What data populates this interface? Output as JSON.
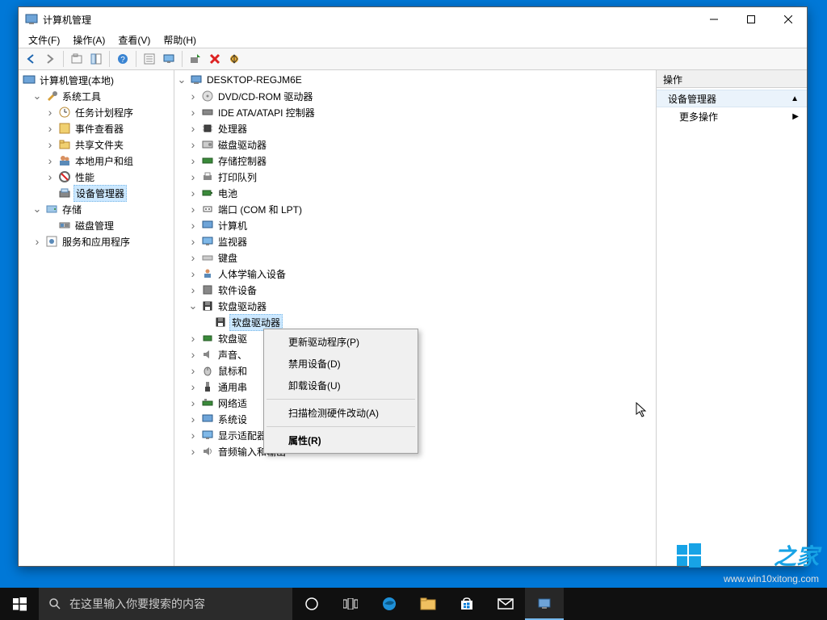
{
  "window": {
    "title": "计算机管理",
    "menus": [
      "文件(F)",
      "操作(A)",
      "查看(V)",
      "帮助(H)"
    ]
  },
  "left_tree": {
    "root": "计算机管理(本地)",
    "system_tools": "系统工具",
    "system_children": [
      "任务计划程序",
      "事件查看器",
      "共享文件夹",
      "本地用户和组",
      "性能",
      "设备管理器"
    ],
    "storage": "存储",
    "storage_children": [
      "磁盘管理"
    ],
    "services": "服务和应用程序"
  },
  "mid_tree": {
    "root": "DESKTOP-REGJM6E",
    "categories": [
      "DVD/CD-ROM 驱动器",
      "IDE ATA/ATAPI 控制器",
      "处理器",
      "磁盘驱动器",
      "存储控制器",
      "打印队列",
      "电池",
      "端口 (COM 和 LPT)",
      "计算机",
      "监视器",
      "键盘",
      "人体学输入设备",
      "软件设备",
      "软盘驱动器",
      "软盘驱动器_child",
      "软盘驱动器控制器",
      "声音、视频和游戏控制器",
      "鼠标和其他指针设备",
      "通用串行总线控制器",
      "网络适配器",
      "系统设备",
      "显示适配器",
      "音频输入和输出"
    ],
    "selected_device": "软盘驱动器",
    "truncated": {
      "floppy_ctrl": "软盘驱",
      "sound": "声音、",
      "mouse": "鼠标和",
      "usb": "通用串",
      "network": "网络适",
      "system": "系统设"
    }
  },
  "context_menu": {
    "items": [
      "更新驱动程序(P)",
      "禁用设备(D)",
      "卸载设备(U)",
      "扫描检测硬件改动(A)",
      "属性(R)"
    ]
  },
  "right_panel": {
    "header": "操作",
    "device_mgr": "设备管理器",
    "more_actions": "更多操作"
  },
  "taskbar": {
    "search_placeholder": "在这里输入你要搜索的内容"
  },
  "watermark": {
    "brand_a": "Win10",
    "brand_b": "之家",
    "url": "www.win10xitong.com"
  }
}
